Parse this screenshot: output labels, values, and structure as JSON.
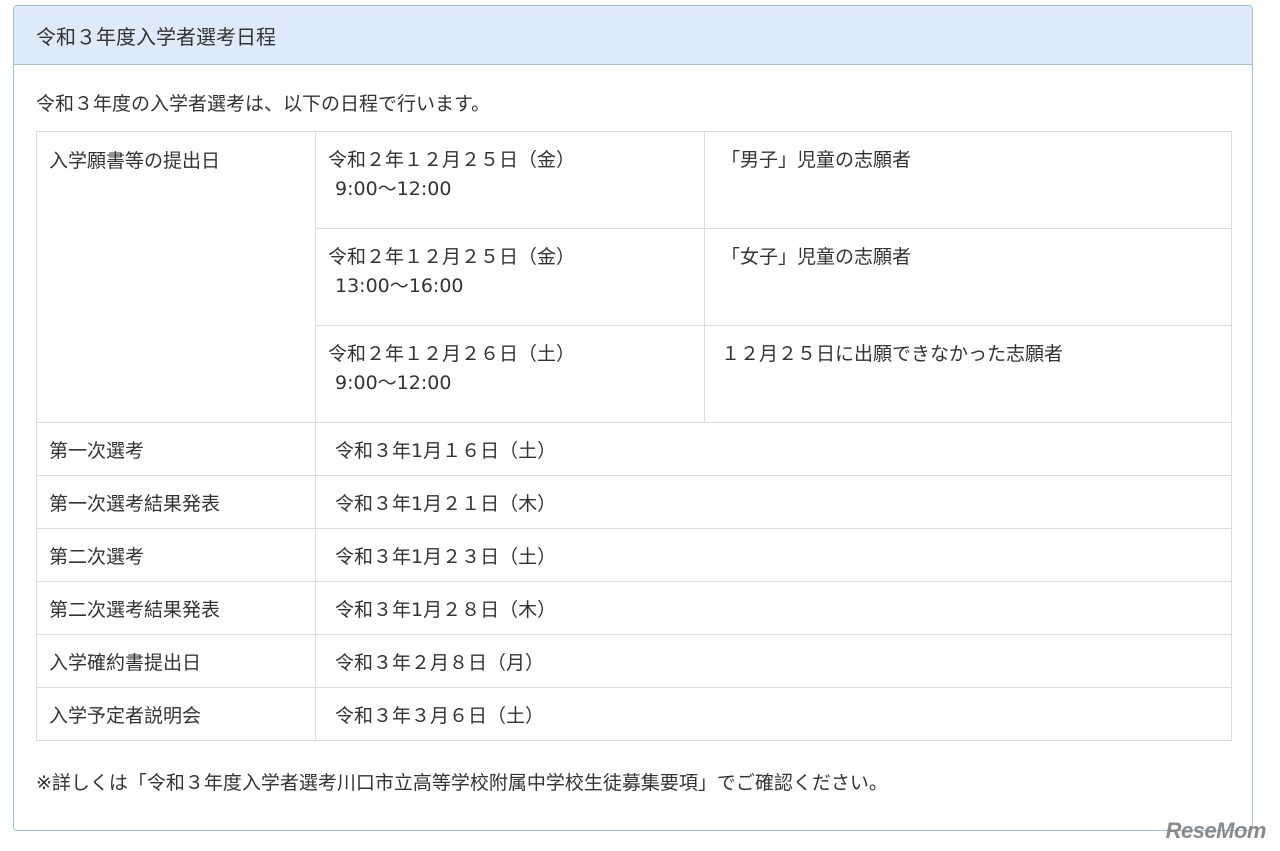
{
  "panel": {
    "title": "令和３年度入学者選考日程"
  },
  "intro": "令和３年度の入学者選考は、以下の日程で行います。",
  "application": {
    "label": "入学願書等の提出日",
    "rows": [
      {
        "date": "令和２年１２月２５日（金）",
        "time": "9:00～12:00",
        "note": "「男子」児童の志願者"
      },
      {
        "date": "令和２年１２月２５日（金）",
        "time": "13:00～16:00",
        "note": "「女子」児童の志願者"
      },
      {
        "date": "令和２年１２月２６日（土）",
        "time": "9:00～12:00",
        "note": "１２月２５日に出願できなかった志願者"
      }
    ]
  },
  "schedule": [
    {
      "label": "第一次選考",
      "date": "令和３年1月１６日（土）"
    },
    {
      "label": "第一次選考結果発表",
      "date": "令和３年1月２１日（木）"
    },
    {
      "label": "第二次選考",
      "date": "令和３年1月２３日（土）"
    },
    {
      "label": "第二次選考結果発表",
      "date": "令和３年1月２８日（木）"
    },
    {
      "label": "入学確約書提出日",
      "date": "令和３年２月８日（月）"
    },
    {
      "label": "入学予定者説明会",
      "date": "令和３年３月６日（土）"
    }
  ],
  "footer_note": "※詳しくは「令和３年度入学者選考川口市立高等学校附属中学校生徒募集要項」でご確認ください。",
  "watermark": "ReseMom",
  "colors": {
    "heading_bg": "#ddeaf9",
    "panel_border": "#9fc1e0",
    "table_border": "#dddddd",
    "text": "#333333"
  }
}
